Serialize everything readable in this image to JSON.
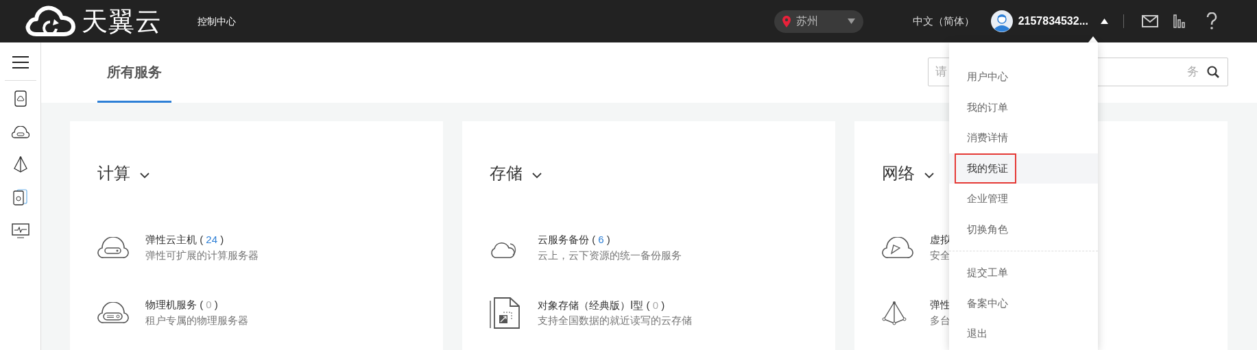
{
  "top_bar": {
    "brand": "天翼云",
    "console_link": "控制中心",
    "region": "苏州",
    "language": "中文（简体）",
    "username": "2157834532..."
  },
  "tabs": [
    {
      "label": "所有服务",
      "selected": true
    }
  ],
  "search": {
    "placeholder": "请",
    "placeholder_tail": "务"
  },
  "categories": [
    {
      "title": "计算",
      "services": [
        {
          "name": "弹性云主机",
          "count_open": "(",
          "count": "24",
          "count_close": ")",
          "has_instances": true,
          "description": "弹性可扩展的计算服务器"
        },
        {
          "name": "物理机服务",
          "count_open": "(",
          "count": "0",
          "count_close": ")",
          "has_instances": false,
          "description": "租户专属的物理服务器"
        }
      ]
    },
    {
      "title": "存储",
      "services": [
        {
          "name": "云服务备份",
          "count_open": "(",
          "count": "6",
          "count_close": ")",
          "has_instances": true,
          "description": "云上，云下资源的统一备份服务"
        },
        {
          "name": "对象存储（经典版）Ⅰ型",
          "count_open": "(",
          "count": "0",
          "count_close": ")",
          "has_instances": false,
          "description": "支持全国数据的就近读写的云存储"
        }
      ]
    },
    {
      "title": "网络",
      "services": [
        {
          "name": "虚拟",
          "description": "安全"
        },
        {
          "name": "弹性",
          "description": "多台"
        }
      ]
    }
  ],
  "user_menu": {
    "groups": [
      [
        {
          "label": "用户中心",
          "selected": false
        },
        {
          "label": "我的订单",
          "selected": false
        },
        {
          "label": "消费详情",
          "selected": false
        },
        {
          "label": "我的凭证",
          "selected": true
        },
        {
          "label": "企业管理",
          "selected": false
        },
        {
          "label": "切换角色",
          "selected": false
        }
      ],
      [
        {
          "label": "提交工单",
          "selected": false
        },
        {
          "label": "备案中心",
          "selected": false
        },
        {
          "label": "退出",
          "selected": false
        }
      ]
    ]
  }
}
